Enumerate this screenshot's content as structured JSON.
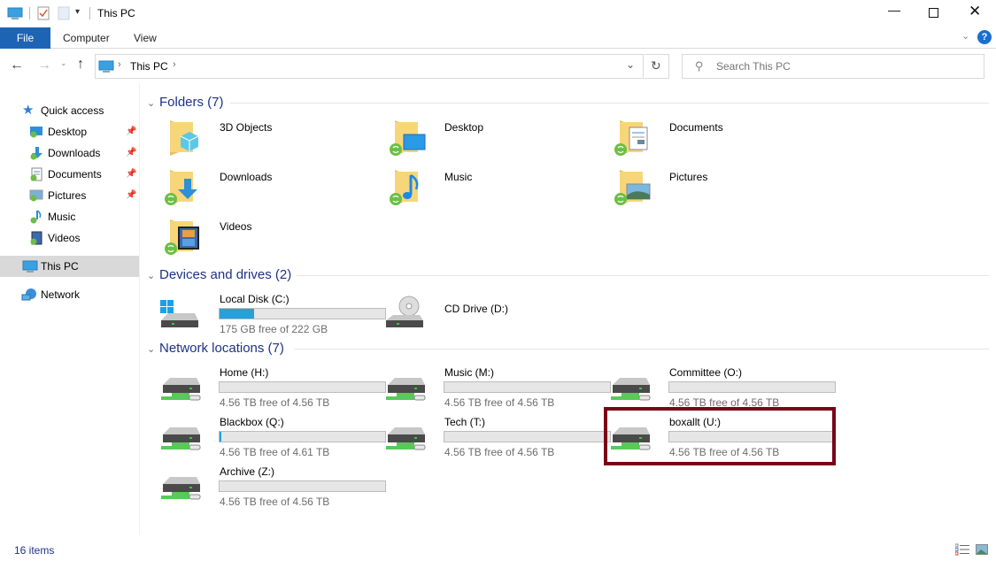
{
  "window": {
    "title": "This PC"
  },
  "quick_access_toolbar": {
    "icons": [
      "computer-icon",
      "properties-icon",
      "new-folder-icon",
      "customize-dropdown-icon"
    ]
  },
  "ribbon": {
    "tabs": [
      {
        "label": "File"
      },
      {
        "label": "Computer"
      },
      {
        "label": "View"
      }
    ]
  },
  "nav": {
    "address_segments": [
      "This PC"
    ],
    "search_placeholder": "Search This PC"
  },
  "sidebar": {
    "quick_access": "Quick access",
    "items": [
      {
        "label": "Desktop",
        "pinned": true
      },
      {
        "label": "Downloads",
        "pinned": true
      },
      {
        "label": "Documents",
        "pinned": true
      },
      {
        "label": "Pictures",
        "pinned": true
      },
      {
        "label": "Music",
        "pinned": false
      },
      {
        "label": "Videos",
        "pinned": false
      }
    ],
    "this_pc": "This PC",
    "network": "Network"
  },
  "groups": {
    "folders": {
      "label": "Folders (7)",
      "items": [
        "3D Objects",
        "Desktop",
        "Documents",
        "Downloads",
        "Music",
        "Pictures",
        "Videos"
      ]
    },
    "devices": {
      "label": "Devices and drives (2)",
      "items": [
        {
          "name": "Local Disk (C:)",
          "free": "175 GB free of 222 GB",
          "used_fraction": 0.21
        },
        {
          "name": "CD Drive (D:)"
        }
      ]
    },
    "network": {
      "label": "Network locations (7)",
      "items": [
        {
          "name": "Home (H:)",
          "free": "4.56 TB free of 4.56 TB",
          "used_fraction": 0.0
        },
        {
          "name": "Music (M:)",
          "free": "4.56 TB free of 4.56 TB",
          "used_fraction": 0.0
        },
        {
          "name": "Committee (O:)",
          "free": "4.56 TB free of 4.56 TB",
          "used_fraction": 0.0
        },
        {
          "name": "Blackbox (Q:)",
          "free": "4.56 TB free of 4.61 TB",
          "used_fraction": 0.011
        },
        {
          "name": "Tech (T:)",
          "free": "4.56 TB free of 4.56 TB",
          "used_fraction": 0.0
        },
        {
          "name": "boxallt (U:)",
          "free": "4.56 TB free of 4.56 TB",
          "used_fraction": 0.0
        },
        {
          "name": "Archive (Z:)",
          "free": "4.56 TB free of 4.56 TB",
          "used_fraction": 0.0
        }
      ]
    }
  },
  "status": {
    "items": "16 items"
  },
  "colors": {
    "accent": "#1e64b4",
    "bar_fill": "#26a0da",
    "highlight": "#7b0018",
    "group_header": "#1e3287"
  }
}
